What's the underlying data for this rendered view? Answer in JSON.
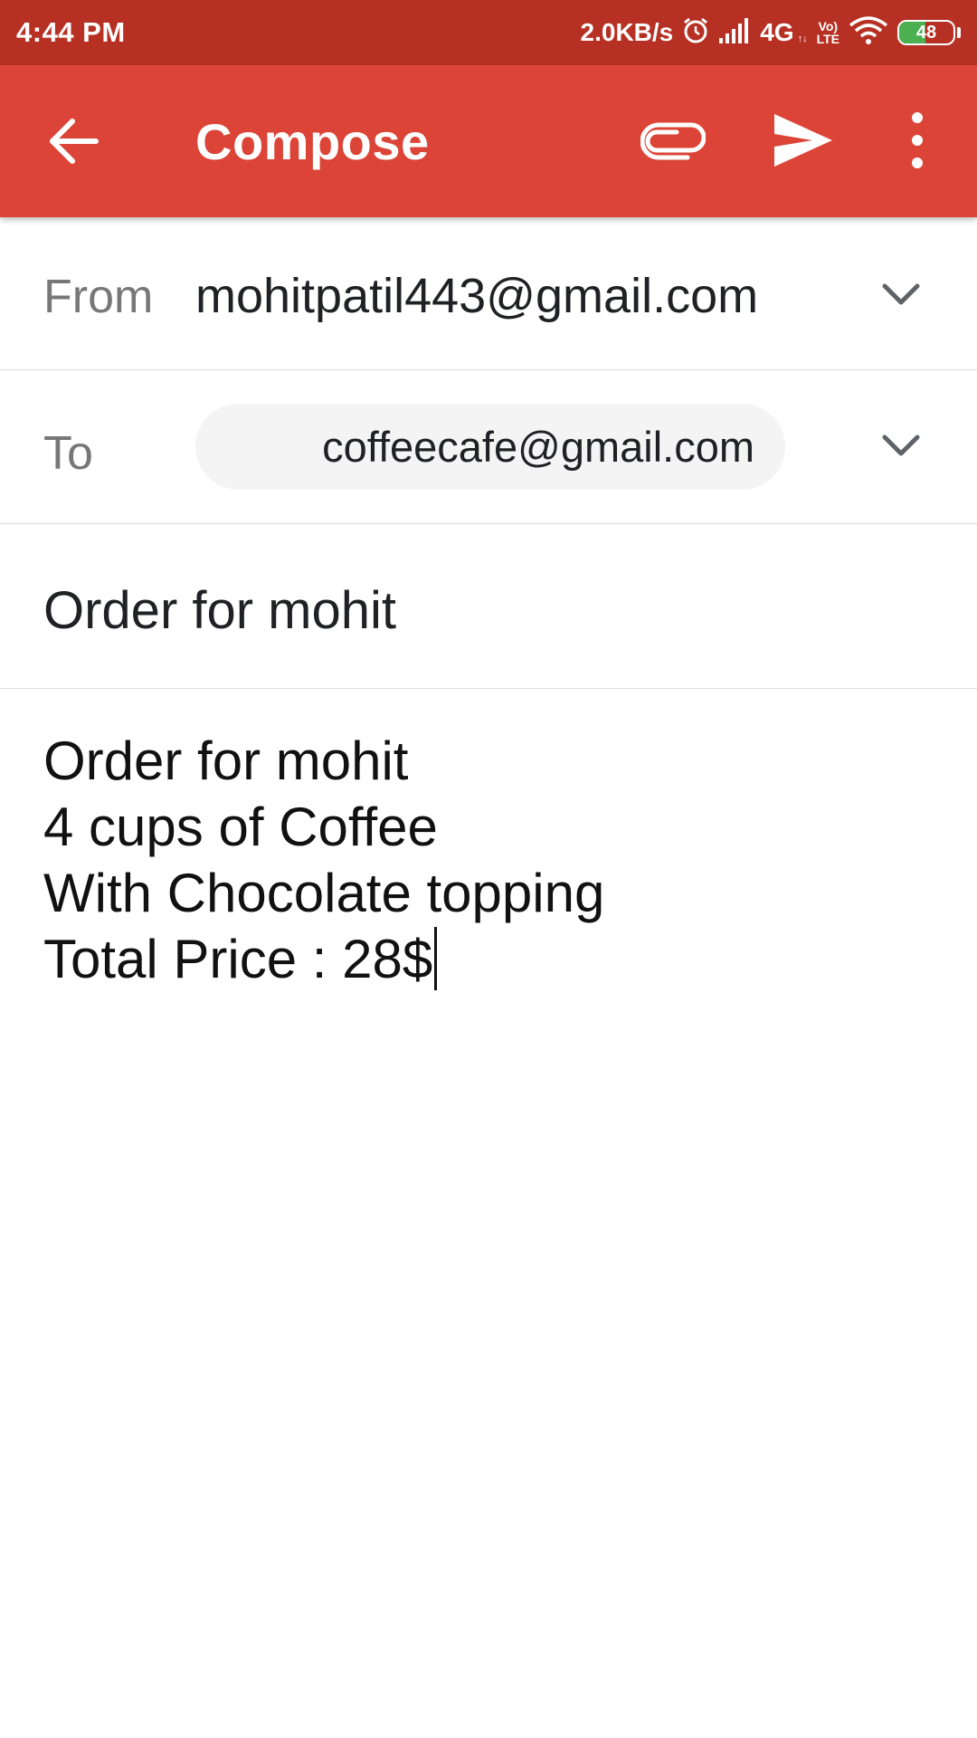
{
  "status_bar": {
    "time": "4:44 PM",
    "speed": "2.0KB/s",
    "network": "4G",
    "network_sub": "↑↓",
    "volte_top": "Vo)",
    "volte_bottom": "LTE",
    "battery": "48",
    "battery_level": 0.48,
    "icons": [
      "alarm-icon",
      "signal-icon",
      "wifi-icon",
      "battery-icon"
    ]
  },
  "app_bar": {
    "title": "Compose",
    "color": "#db4437",
    "icons": [
      "back-arrow-icon",
      "paperclip-icon",
      "send-icon",
      "more-vert-icon"
    ]
  },
  "compose": {
    "from_label": "From",
    "from_value": "mohitpatil443@gmail.com",
    "to_label": "To",
    "to_chip": "coffeecafe@gmail.com",
    "subject": "Order for mohit",
    "body_lines": [
      "Order for mohit",
      "4 cups of Coffee",
      "With Chocolate topping",
      "Total Price : 28$"
    ]
  }
}
